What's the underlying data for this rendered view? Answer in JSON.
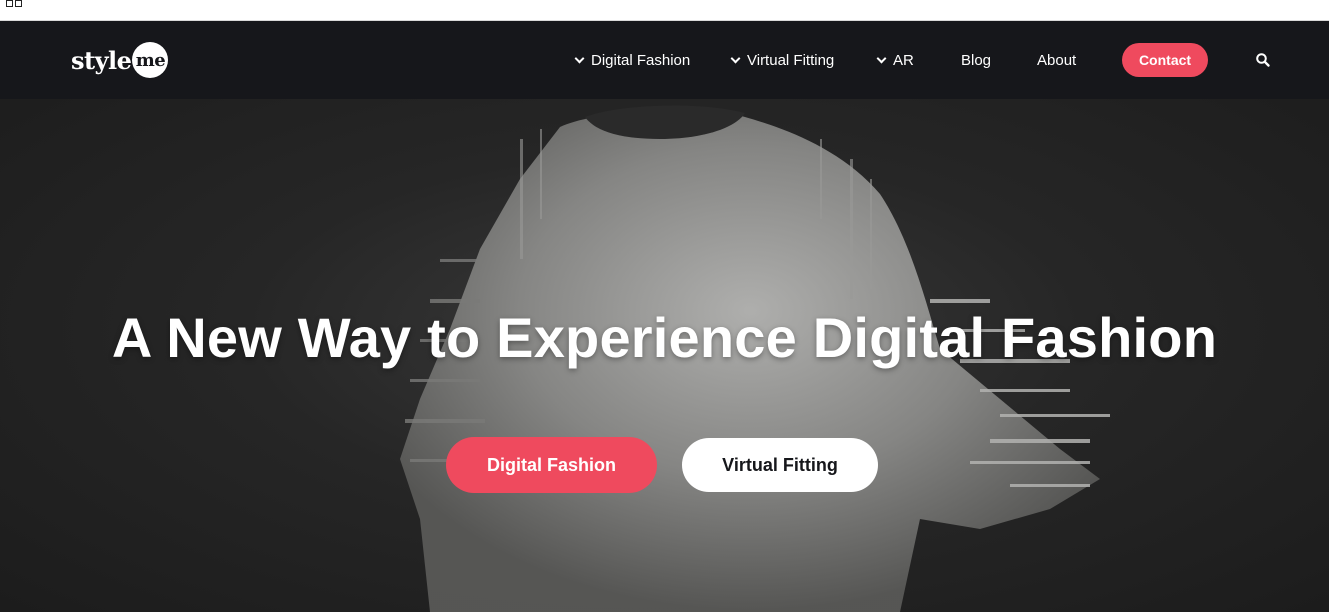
{
  "brand": {
    "logo_word": "style",
    "logo_badge": "me"
  },
  "nav": {
    "items": [
      {
        "label": "Digital Fashion",
        "dropdown": true
      },
      {
        "label": "Virtual Fitting",
        "dropdown": true
      },
      {
        "label": "AR",
        "dropdown": true
      },
      {
        "label": "Blog",
        "dropdown": false
      },
      {
        "label": "About",
        "dropdown": false
      }
    ],
    "contact_label": "Contact",
    "search_icon": "search-icon"
  },
  "hero": {
    "title": "A New Way to Experience Digital Fashion",
    "primary_button": "Digital Fashion",
    "secondary_button": "Virtual Fitting",
    "background_image": "glitched-shirt-silhouette"
  },
  "colors": {
    "accent": "#ef4a5e",
    "header_bg": "#16171b",
    "hero_bg": "#262626",
    "text_light": "#ffffff"
  }
}
